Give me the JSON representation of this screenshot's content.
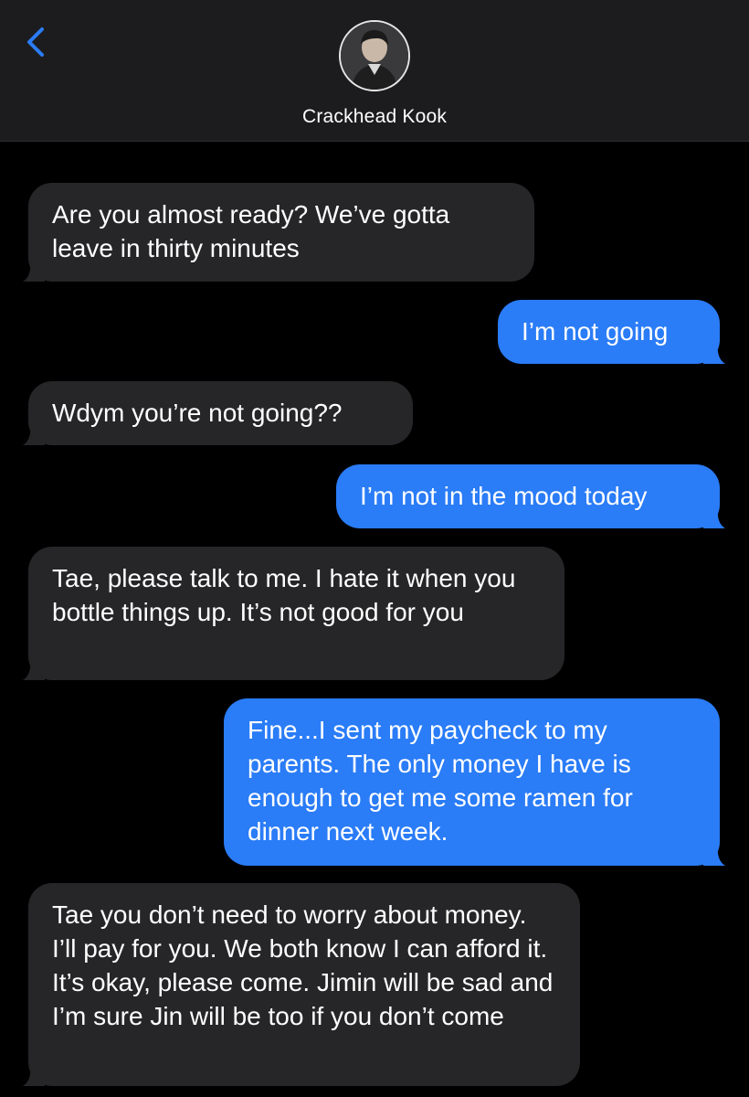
{
  "header": {
    "contact_name": "Crackhead Kook",
    "back_icon": "chevron-left-icon",
    "accent_color": "#2a7cf7"
  },
  "messages": [
    {
      "direction": "incoming",
      "text": "Are you almost ready? We’ve gotta leave in thirty minutes"
    },
    {
      "direction": "outgoing",
      "text": "I’m not going"
    },
    {
      "direction": "incoming",
      "text": "Wdym you’re not going??"
    },
    {
      "direction": "outgoing",
      "text": "I’m not in the mood today"
    },
    {
      "direction": "incoming",
      "text": "Tae, please talk to me. I hate it when you bottle things up. It’s not good for you"
    },
    {
      "direction": "outgoing",
      "text": "Fine...I sent my paycheck to my parents. The only money I have is enough to get me some ramen for dinner next week."
    },
    {
      "direction": "incoming",
      "text": "Tae you don’t need to worry about money. I’ll pay for you. We both know I can afford it. It’s okay, please come. Jimin will be sad and I’m sure Jin will be too if you don’t come"
    }
  ],
  "colors": {
    "incoming_bubble": "#262628",
    "outgoing_bubble": "#2a7cf7",
    "header_bg": "#1c1c1e",
    "background": "#000000"
  }
}
